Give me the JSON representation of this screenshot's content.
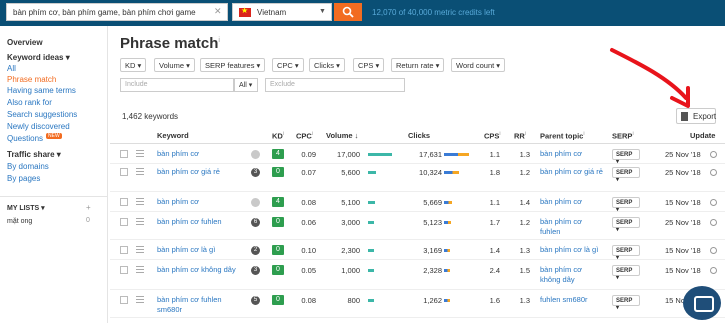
{
  "topbar": {
    "search_value": "bàn phím cơ, bàn phím game, bàn phím chơi game",
    "country": "Vietnam",
    "credits": "12,070 of 40,000 metric credits left"
  },
  "sidebar": {
    "overview": "Overview",
    "keyword_ideas": "Keyword ideas ▾",
    "items": [
      "All",
      "Phrase match",
      "Having same terms",
      "Also rank for",
      "Search suggestions",
      "Newly discovered",
      "Questions"
    ],
    "questions_badge": "NEW",
    "traffic_share": "Traffic share ▾",
    "traffic_items": [
      "By domains",
      "By pages"
    ],
    "my_lists": "MY LISTS ▾",
    "my_lists_add": "+",
    "list_name": "mặt ong",
    "list_count": "0"
  },
  "main": {
    "title": "Phrase match",
    "title_info": "i",
    "filters": [
      "KD ▾",
      "Volume ▾",
      "SERP features ▾",
      "CPC ▾",
      "Clicks ▾",
      "CPS ▾",
      "Return rate ▾",
      "Word count ▾"
    ],
    "include_placeholder": "Include",
    "all_label": "All ▾",
    "exclude_placeholder": "Exclude",
    "count": "1,462 keywords",
    "export_label": "Export"
  },
  "table": {
    "headers": [
      "Keyword",
      "KD",
      "CPC",
      "Volume ↓",
      "Clicks",
      "CPS",
      "RR",
      "Parent topic",
      "SERP",
      "Update"
    ],
    "header_info": "i",
    "serp_label": "SERP ▾",
    "rows": [
      {
        "kw": "bàn phím cơ",
        "dot": "",
        "dot_light": true,
        "kd": "4",
        "cpc": "0.09",
        "vol": "17,000",
        "clicks": "17,631",
        "cps": "1.1",
        "rr": "1.3",
        "parent": "bàn phím cơ",
        "upd": "25 Nov '18"
      },
      {
        "kw": "bàn phím cơ giá rẻ",
        "dot": "3",
        "dot_light": false,
        "kd": "0",
        "cpc": "0.07",
        "vol": "5,600",
        "clicks": "10,324",
        "cps": "1.8",
        "rr": "1.2",
        "parent": "bàn phím cơ giá rẻ",
        "upd": "25 Nov '18"
      },
      {
        "kw": "bàn phím cơ",
        "dot": "",
        "dot_light": true,
        "kd": "4",
        "cpc": "0.08",
        "vol": "5,100",
        "clicks": "5,669",
        "cps": "1.1",
        "rr": "1.4",
        "parent": "bàn phím cơ",
        "upd": "15 Nov '18"
      },
      {
        "kw": "bàn phím cơ fuhlen",
        "dot": "6",
        "dot_light": false,
        "kd": "0",
        "cpc": "0.06",
        "vol": "3,000",
        "clicks": "5,123",
        "cps": "1.7",
        "rr": "1.2",
        "parent": "bàn phím cơ fuhlen",
        "upd": "25 Nov '18"
      },
      {
        "kw": "bàn phím cơ là gì",
        "dot": "2",
        "dot_light": false,
        "kd": "0",
        "cpc": "0.10",
        "vol": "2,300",
        "clicks": "3,169",
        "cps": "1.4",
        "rr": "1.3",
        "parent": "bàn phím cơ là gì",
        "upd": "15 Nov '18"
      },
      {
        "kw": "bàn phím cơ không dây",
        "dot": "3",
        "dot_light": false,
        "kd": "0",
        "cpc": "0.05",
        "vol": "1,000",
        "clicks": "2,328",
        "cps": "2.4",
        "rr": "1.5",
        "parent": "bàn phím cơ không dây",
        "upd": "15 Nov '18"
      },
      {
        "kw": "bàn phím cơ fuhlen sm680r",
        "dot": "5",
        "dot_light": false,
        "kd": "0",
        "cpc": "0.08",
        "vol": "800",
        "clicks": "1,262",
        "cps": "1.6",
        "rr": "1.3",
        "parent": "fuhlen sm680r",
        "upd": "15 Nov '18"
      }
    ]
  },
  "colors": {
    "topbar": "#0a4f75",
    "accent": "#f26c21",
    "link": "#2a77c1",
    "kd_green": "#2e9e4f",
    "annotation": "#e8141b"
  }
}
